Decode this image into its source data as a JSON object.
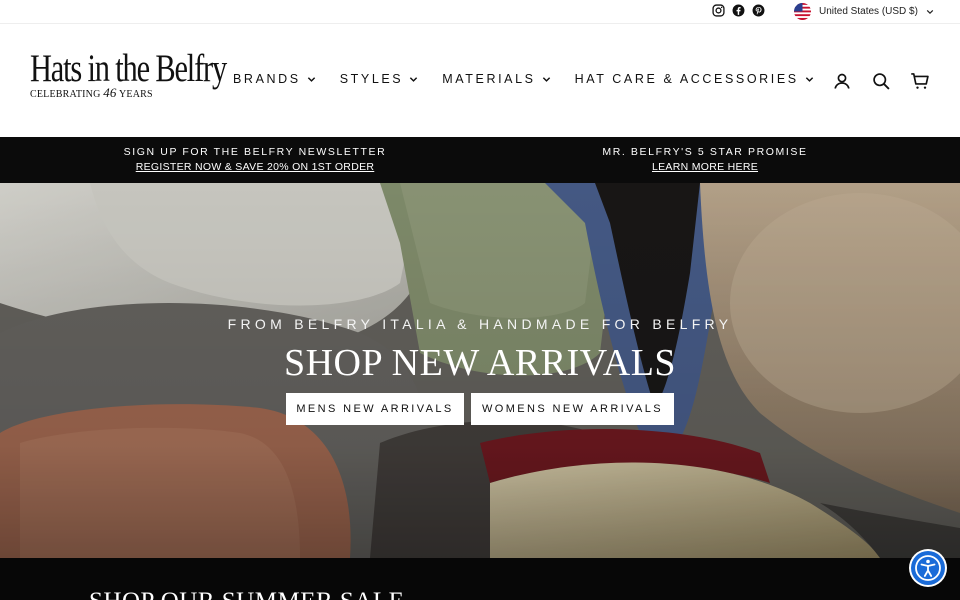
{
  "utility_bar": {
    "social_icons": [
      "instagram-icon",
      "facebook-icon",
      "pinterest-icon"
    ],
    "currency_label": "United States (USD $)"
  },
  "header": {
    "logo": {
      "name": "Hats in the Belfry",
      "tagline_prefix": "CELEBRATING",
      "tagline_number": "46",
      "tagline_suffix": "YEARS"
    },
    "nav": [
      {
        "label": "BRANDS"
      },
      {
        "label": "STYLES"
      },
      {
        "label": "MATERIALS"
      },
      {
        "label": "HAT CARE & ACCESSORIES"
      }
    ],
    "icons": [
      "account-icon",
      "search-icon",
      "cart-icon"
    ]
  },
  "announcement": [
    {
      "title": "SIGN UP FOR THE BELFRY NEWSLETTER",
      "link": "REGISTER NOW & SAVE 20% ON 1ST ORDER"
    },
    {
      "title": "MR. BELFRY'S 5 STAR PROMISE",
      "link": "LEARN MORE HERE"
    }
  ],
  "hero": {
    "eyebrow": "FROM BELFRY ITALIA & HANDMADE FOR BELFRY",
    "title": "SHOP NEW ARRIVALS",
    "buttons": {
      "men": "MENS NEW ARRIVALS",
      "women": "WOMENS NEW ARRIVALS"
    }
  },
  "section": {
    "title": "SHOP OUR SUMMER SALE"
  },
  "colors": {
    "announcement_bg": "#0b0b0b",
    "accessibility_button": "#1a6bd8"
  }
}
